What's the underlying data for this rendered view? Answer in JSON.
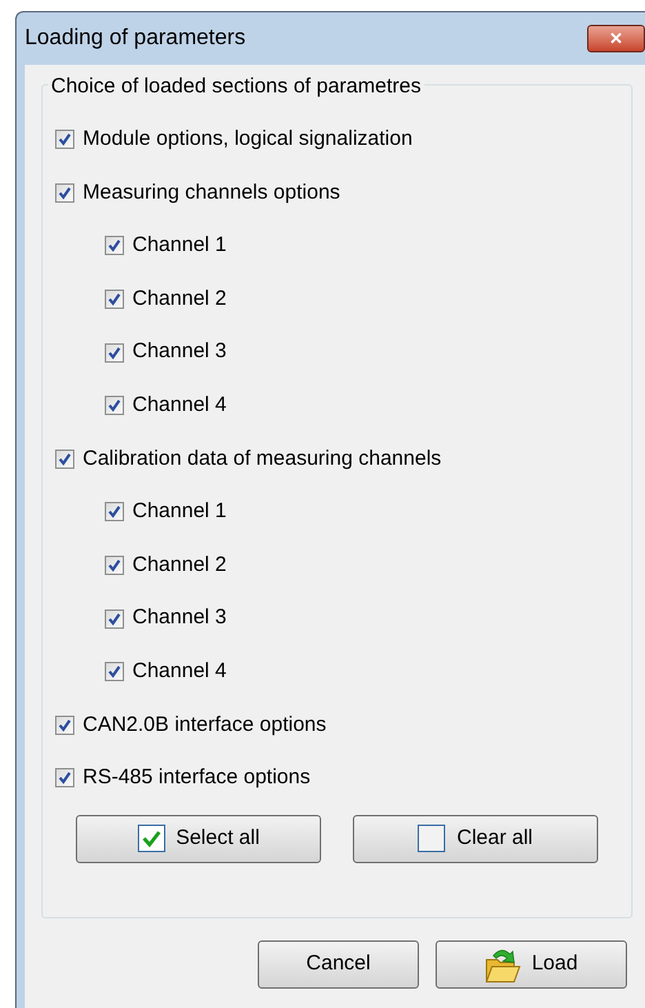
{
  "window": {
    "title": "Loading of parameters",
    "close": "✕"
  },
  "group": {
    "title": "Choice of loaded sections of parametres",
    "sections": [
      {
        "label": "Module options, logical signalization",
        "checked": true
      },
      {
        "label": "Measuring channels options",
        "checked": true,
        "children": [
          {
            "label": "Channel 1",
            "checked": true
          },
          {
            "label": "Channel 2",
            "checked": true
          },
          {
            "label": "Channel 3",
            "checked": true
          },
          {
            "label": "Channel 4",
            "checked": true
          }
        ]
      },
      {
        "label": "Calibration data of measuring channels",
        "checked": true,
        "children": [
          {
            "label": "Channel 1",
            "checked": true
          },
          {
            "label": "Channel 2",
            "checked": true
          },
          {
            "label": "Channel 3",
            "checked": true
          },
          {
            "label": "Channel 4",
            "checked": true
          }
        ]
      },
      {
        "label": "CAN2.0B interface options",
        "checked": true
      },
      {
        "label": "RS-485 interface options",
        "checked": true
      }
    ],
    "buttons": [
      {
        "label": "Select all",
        "kind": "check"
      },
      {
        "label": "Clear all",
        "kind": "empty"
      }
    ]
  },
  "buttons": [
    {
      "label": "Cancel",
      "kind": "plain"
    },
    {
      "label": "Load",
      "kind": "load"
    }
  ]
}
